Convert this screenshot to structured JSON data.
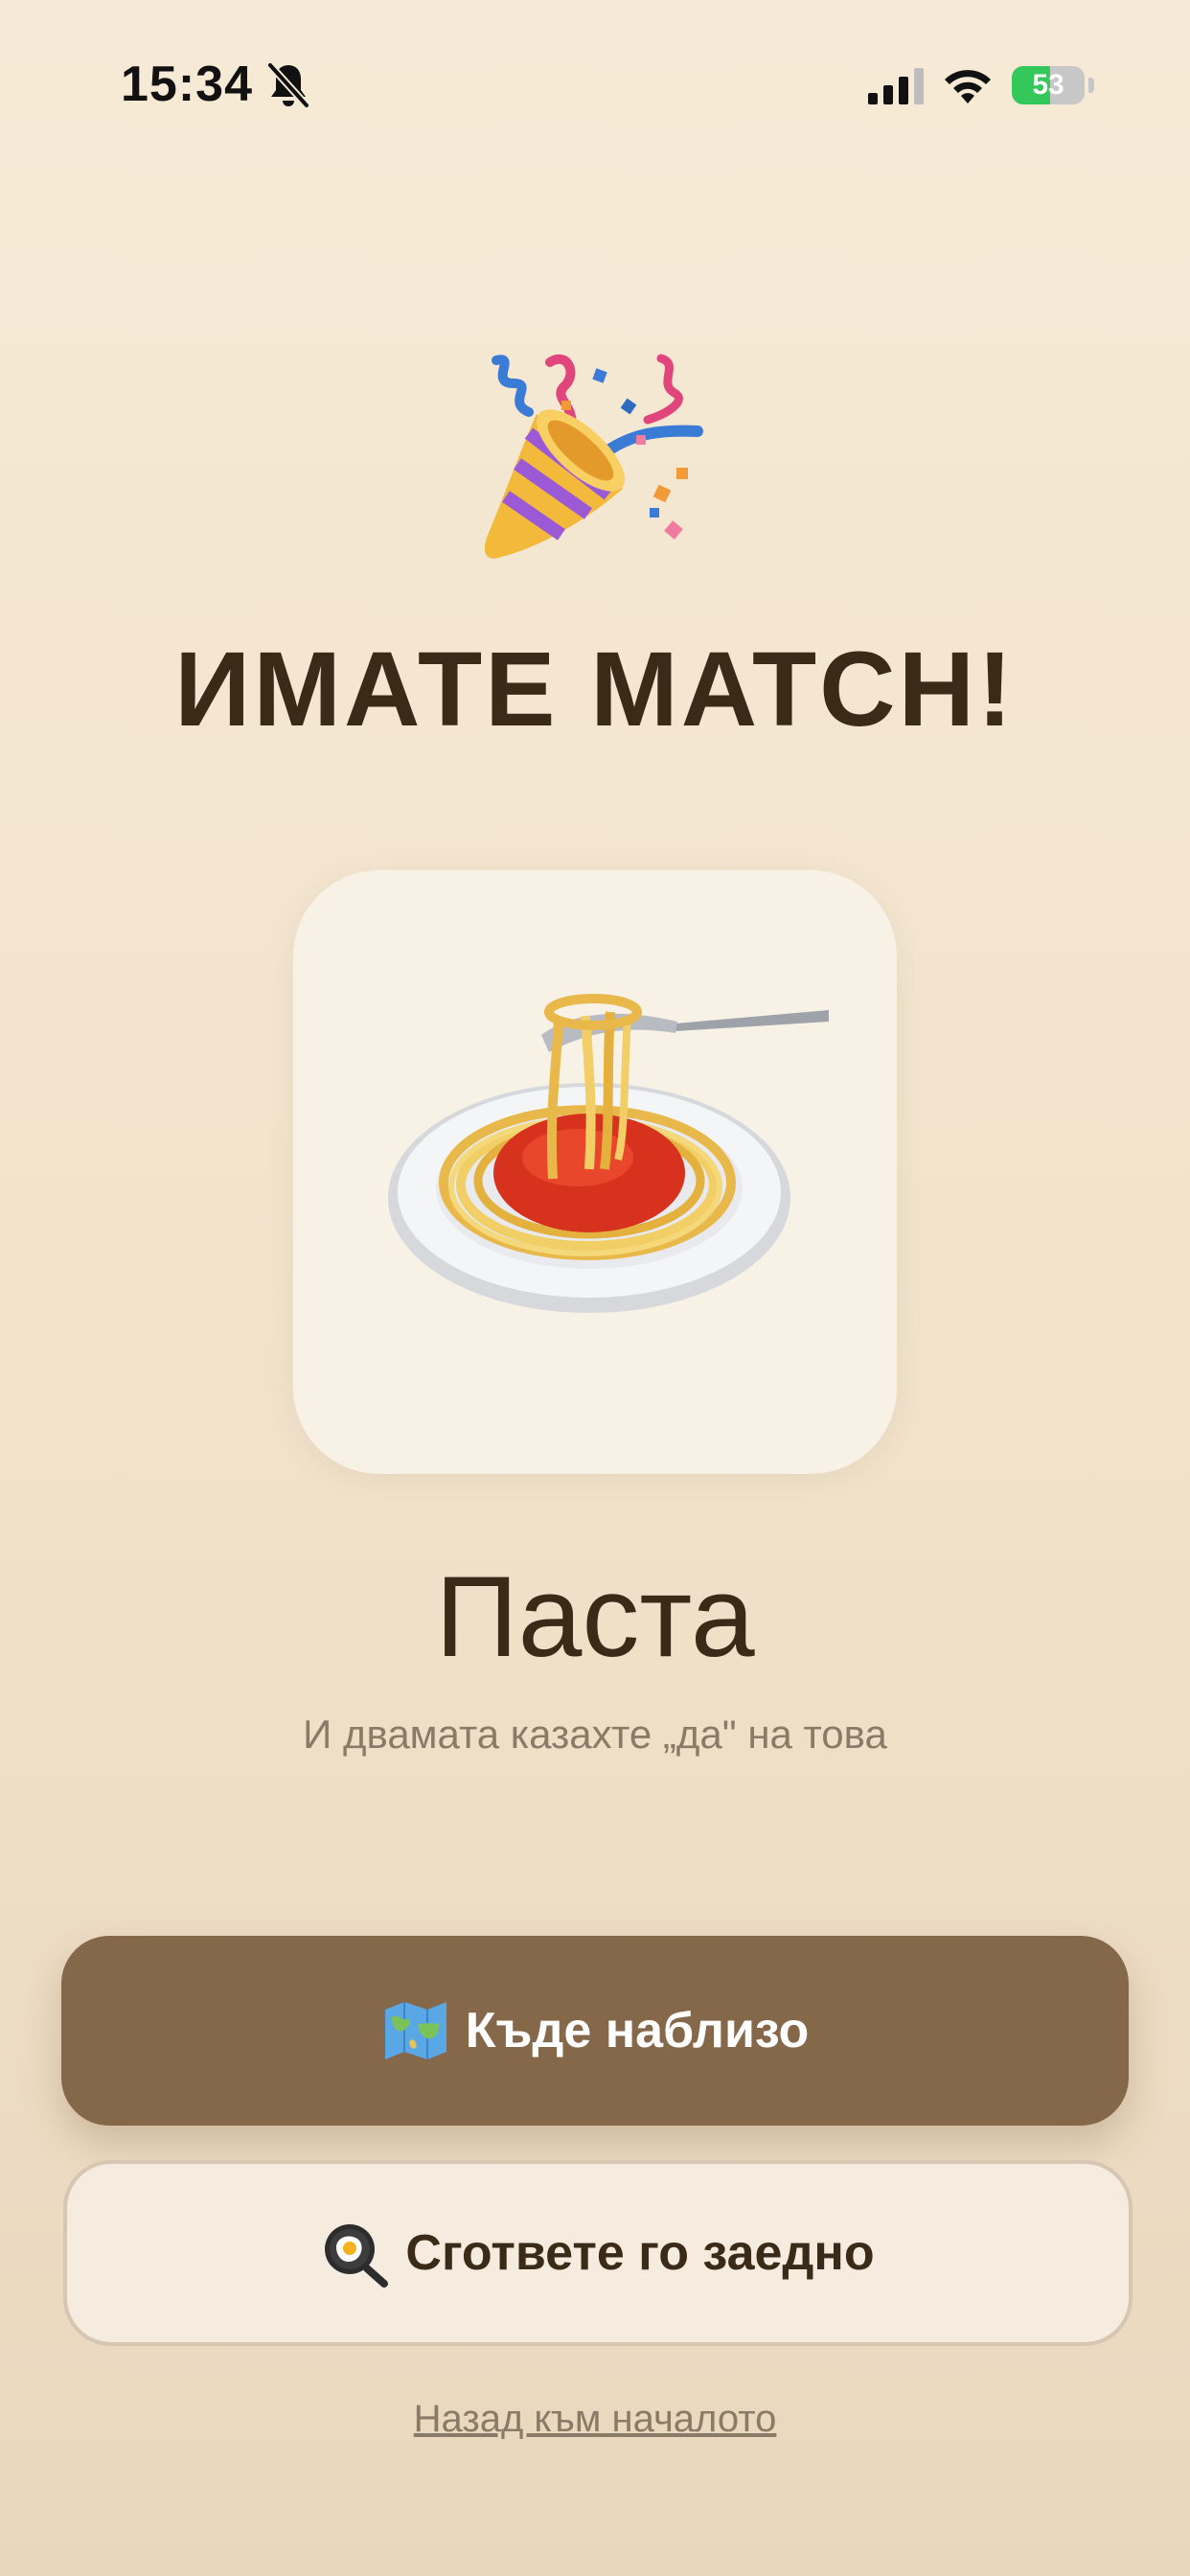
{
  "status_bar": {
    "time": "15:34",
    "battery_percent": "53",
    "icons": [
      "bell-slash-icon",
      "cellular-signal-icon",
      "wifi-icon",
      "battery-charging-icon"
    ]
  },
  "match": {
    "icon": "party-popper-icon",
    "title": "ИМАТЕ MATCH!",
    "dish_icon": "spaghetti-icon",
    "dish_name": "Паста",
    "subtitle": "И двамата казахте „да\" на това"
  },
  "actions": {
    "nearby": {
      "icon": "world-map-icon",
      "label": "Къде наблизо"
    },
    "cook": {
      "icon": "frying-pan-egg-icon",
      "label": "Сгответе го заедно"
    },
    "back": {
      "label": "Назад към началото"
    }
  },
  "colors": {
    "background": "#f4e6d1",
    "primary_button": "#85674a",
    "secondary_button": "#f5ebdf",
    "title_text": "#3a2a18",
    "muted_text": "#8a7a68",
    "battery_fill": "#34c759"
  }
}
